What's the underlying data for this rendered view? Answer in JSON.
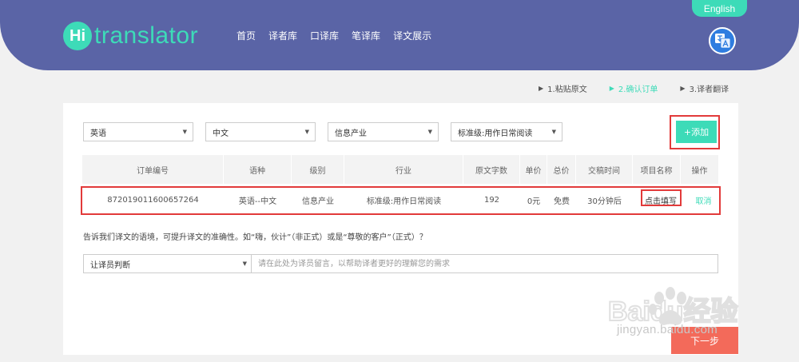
{
  "header": {
    "logo_hi": "Hi",
    "logo_text": "translator",
    "nav": [
      "首页",
      "译者库",
      "口译库",
      "笔译库",
      "译文展示"
    ],
    "language_button": "English"
  },
  "steps": [
    {
      "label": "1.粘贴原文",
      "active": false
    },
    {
      "label": "2.确认订单",
      "active": true
    },
    {
      "label": "3.译者翻译",
      "active": false
    }
  ],
  "filters": {
    "source_language": "英语",
    "target_language": "中文",
    "industry": "信息产业",
    "level": "标准级:用作日常阅读",
    "add_button": "+添加"
  },
  "table": {
    "headers": [
      "订单编号",
      "语种",
      "级别",
      "行业",
      "原文字数",
      "单价",
      "总价",
      "交稿时间",
      "项目名称",
      "操作"
    ],
    "rows": [
      [
        "872019011600657264",
        "英语--中文",
        "信息产业",
        "标准级:用作日常阅读",
        "192",
        "0元",
        "免费",
        "30分钟后",
        "点击填写",
        "取消"
      ]
    ]
  },
  "message": {
    "question": "告诉我们译文的语境，可提升译文的准确性。如“嗨，伙计”（非正式）或是“尊敬的客户”（正式）？",
    "tone_select": "让译员判断",
    "placeholder": "请在此处为译员留言，以帮助译者更好的理解您的需求"
  },
  "next_button": "下一步",
  "watermark": {
    "brand": "Baidu经验",
    "url": "jingyan.baidu.com"
  },
  "colors": {
    "header_bg": "#5a64a6",
    "accent": "#3ddbb8",
    "highlight": "#e23a3a",
    "next_button": "#f36a5a"
  }
}
